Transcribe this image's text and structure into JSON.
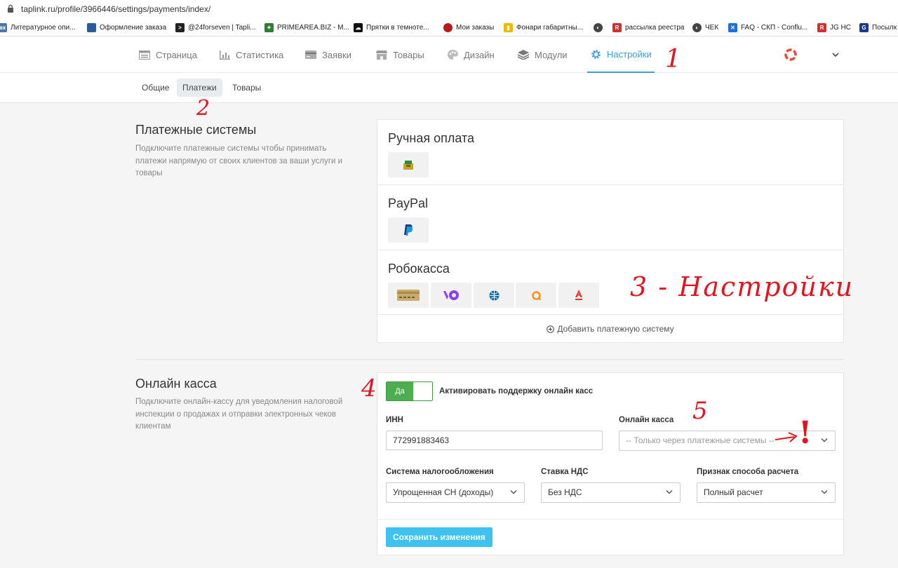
{
  "browser": {
    "url": "taplink.ru/profile/3966446/settings/payments/index/",
    "bookmarks": [
      {
        "label": "Литературное опи...",
        "color": "#4a76a8",
        "glyph": "вк"
      },
      {
        "label": "Оформление заказа",
        "color": "#2b5c9a",
        "glyph": ""
      },
      {
        "label": "@24forseven | Tapli...",
        "color": "#222222",
        "glyph": ">"
      },
      {
        "label": "PRIMEAREA.BIZ - M...",
        "color": "#2e7d32",
        "glyph": "✦"
      },
      {
        "label": "Прятки в темноте...",
        "color": "#111111",
        "glyph": "☁"
      },
      {
        "label": "Мои заказы",
        "color": "#b71c1c",
        "glyph": "●"
      },
      {
        "label": "Фонари габаритны...",
        "color": "#f2b705",
        "glyph": "▮"
      },
      {
        "label": "",
        "color": "#444444",
        "glyph": "◐"
      },
      {
        "label": "рассылка реестра",
        "color": "#d32f2f",
        "glyph": "R"
      },
      {
        "label": "ЧЕК",
        "color": "#444444",
        "glyph": "◐"
      },
      {
        "label": "FAQ - СКП - Conflu...",
        "color": "#1e6fd9",
        "glyph": "✕"
      },
      {
        "label": "JG HC",
        "color": "#d32f2f",
        "glyph": "R"
      },
      {
        "label": "Посылк",
        "color": "#1a3a8a",
        "glyph": "G"
      }
    ]
  },
  "nav": {
    "items": [
      {
        "label": "Страница",
        "icon": "page-icon"
      },
      {
        "label": "Статистика",
        "icon": "stats-icon"
      },
      {
        "label": "Заявки",
        "icon": "requests-icon"
      },
      {
        "label": "Товары",
        "icon": "store-icon"
      },
      {
        "label": "Дизайн",
        "icon": "palette-icon"
      },
      {
        "label": "Модули",
        "icon": "layers-icon"
      },
      {
        "label": "Настройки",
        "icon": "gear-icon",
        "active": true
      }
    ],
    "help_icon": "lifebuoy-icon",
    "menu_icon": "chevron-down-icon"
  },
  "subnav": {
    "items": [
      {
        "label": "Общие"
      },
      {
        "label": "Платежи",
        "active": true
      },
      {
        "label": "Товары"
      }
    ]
  },
  "payments": {
    "title": "Платежные системы",
    "description": "Подключите платежные системы чтобы принимать платежи напрямую от своих клиентов за ваши услуги и товары",
    "systems": [
      {
        "name": "Ручная оплата",
        "methods": [
          "cash-register-icon"
        ]
      },
      {
        "name": "PayPal",
        "methods": [
          "paypal-icon"
        ]
      },
      {
        "name": "Робокасса",
        "methods": [
          "bank-card-icon",
          "yoomoney-icon",
          "webmoney-icon",
          "qiwi-icon",
          "alfa-bank-icon"
        ]
      }
    ],
    "add_label": "Добавить платежную систему"
  },
  "kassa": {
    "title": "Онлайн касса",
    "description": "Подключите онлайн-кассу для уведомления налоговой инспекции о продажах и отправки электронных чеков клиентам",
    "toggle_label": "Да",
    "toggle_on": true,
    "activate_label": "Активировать поддержку онлайн касс",
    "inn_label": "ИНН",
    "inn_value": "772991883463",
    "kassa_label": "Онлайн касса",
    "kassa_placeholder": "-- Только через платежные системы --",
    "tax_label": "Система налогообложения",
    "tax_value": "Упрощенная СН (доходы)",
    "vat_label": "Ставка НДС",
    "vat_value": "Без НДС",
    "calc_label": "Признак способа расчета",
    "calc_value": "Полный расчет",
    "save_label": "Сохранить изменения"
  },
  "annotations": {
    "n1": "1",
    "n2": "2",
    "n3": "3 - Настройки",
    "n4": "4",
    "n5": "5",
    "warn": "!"
  },
  "colors": {
    "accent": "#3aa0d8",
    "toggle_green": "#4cae4f",
    "save_button": "#3ec3f0",
    "annotation_red": "#e4141e"
  }
}
